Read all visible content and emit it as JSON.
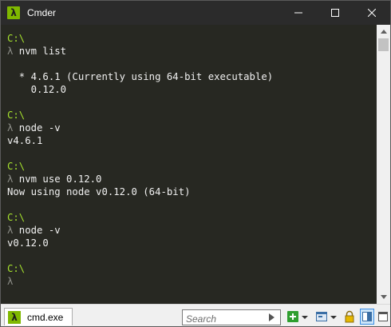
{
  "window": {
    "title": "Cmder",
    "app_icon_glyph": "λ"
  },
  "console": {
    "lines": [
      {
        "type": "path",
        "text": "C:\\"
      },
      {
        "type": "prompt",
        "text": "λ nvm list"
      },
      {
        "type": "blank",
        "text": ""
      },
      {
        "type": "output",
        "text": "  * 4.6.1 (Currently using 64-bit executable)"
      },
      {
        "type": "output",
        "text": "    0.12.0"
      },
      {
        "type": "blank",
        "text": ""
      },
      {
        "type": "path",
        "text": "C:\\"
      },
      {
        "type": "prompt",
        "text": "λ node -v"
      },
      {
        "type": "output",
        "text": "v4.6.1"
      },
      {
        "type": "blank",
        "text": ""
      },
      {
        "type": "path",
        "text": "C:\\"
      },
      {
        "type": "prompt",
        "text": "λ nvm use 0.12.0"
      },
      {
        "type": "output",
        "text": "Now using node v0.12.0 (64-bit)"
      },
      {
        "type": "blank",
        "text": ""
      },
      {
        "type": "path",
        "text": "C:\\"
      },
      {
        "type": "prompt",
        "text": "λ node -v"
      },
      {
        "type": "output",
        "text": "v0.12.0"
      },
      {
        "type": "blank",
        "text": ""
      },
      {
        "type": "path",
        "text": "C:\\"
      },
      {
        "type": "prompt",
        "text": "λ"
      }
    ]
  },
  "statusbar": {
    "tab_label": "cmd.exe",
    "tab_icon_glyph": "λ",
    "search_placeholder": "Search",
    "icons": [
      "new-console-icon",
      "dropdown-arrow-icon",
      "console-window-icon",
      "dropdown-arrow-icon",
      "lock-icon",
      "split-view-icon",
      "maximize-icon"
    ]
  },
  "colors": {
    "background": "#272822",
    "path": "#a6e22e",
    "lambda": "#8f908a",
    "text": "#f0f0f0",
    "accent": "#7fb800"
  }
}
